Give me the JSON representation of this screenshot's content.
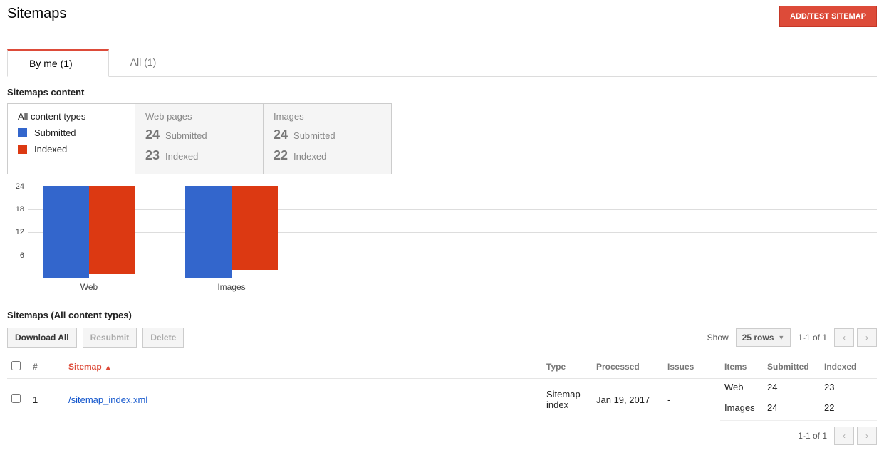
{
  "header": {
    "title": "Sitemaps",
    "add_button": "ADD/TEST SITEMAP"
  },
  "tabs": {
    "by_me": "By me (1)",
    "all": "All (1)"
  },
  "section": {
    "content_heading": "Sitemaps content",
    "table_heading": "Sitemaps (All content types)"
  },
  "legend": {
    "title": "All content types",
    "submitted": "Submitted",
    "indexed": "Indexed"
  },
  "stats": {
    "web": {
      "title": "Web pages",
      "submitted_num": "24",
      "submitted_label": "Submitted",
      "indexed_num": "23",
      "indexed_label": "Indexed"
    },
    "images": {
      "title": "Images",
      "submitted_num": "24",
      "submitted_label": "Submitted",
      "indexed_num": "22",
      "indexed_label": "Indexed"
    }
  },
  "chart_data": {
    "type": "bar",
    "categories": [
      "Web",
      "Images"
    ],
    "series": [
      {
        "name": "Submitted",
        "values": [
          24,
          24
        ]
      },
      {
        "name": "Indexed",
        "values": [
          23,
          22
        ]
      }
    ],
    "y_ticks": [
      6,
      12,
      18,
      24
    ],
    "ylim": [
      0,
      26
    ],
    "colors": {
      "Submitted": "#3366cc",
      "Indexed": "#dc3912"
    }
  },
  "toolbar": {
    "download": "Download All",
    "resubmit": "Resubmit",
    "delete": "Delete",
    "show_label": "Show",
    "rows_select": "25 rows",
    "page_info": "1-1 of 1"
  },
  "table": {
    "cols": {
      "num": "#",
      "sitemap": "Sitemap",
      "type": "Type",
      "processed": "Processed",
      "issues": "Issues",
      "items": "Items",
      "submitted": "Submitted",
      "indexed": "Indexed"
    },
    "row": {
      "num": "1",
      "sitemap": "/sitemap_index.xml",
      "type": "Sitemap index",
      "processed": "Jan 19, 2017",
      "issues": "-",
      "items_web": "Web",
      "items_images": "Images",
      "sub_web": "24",
      "sub_images": "24",
      "idx_web": "23",
      "idx_images": "22"
    }
  }
}
